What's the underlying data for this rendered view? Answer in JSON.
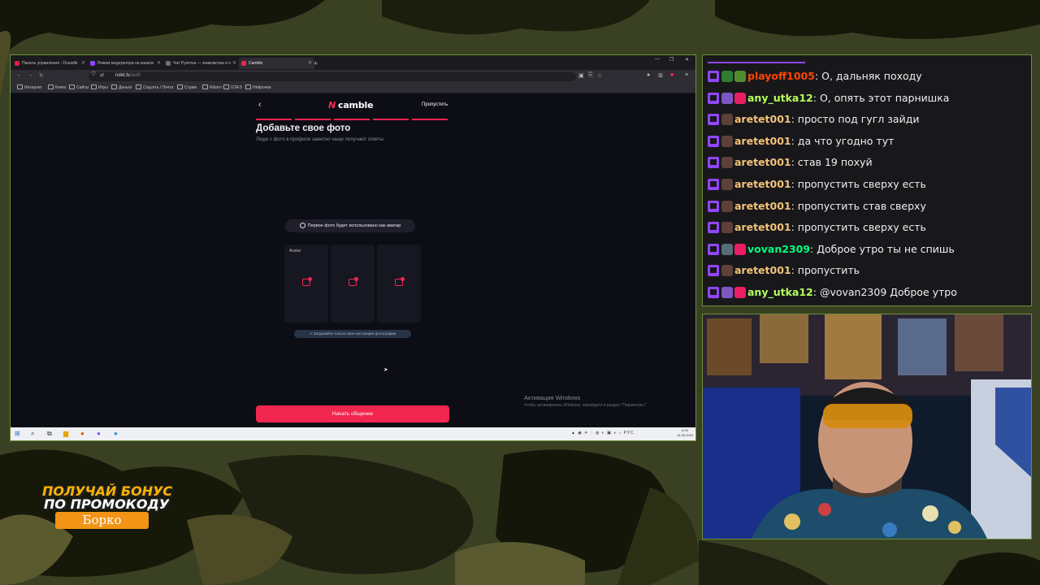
{
  "browser": {
    "tabs": [
      {
        "label": "Панель управления - Dceadki",
        "color": "#e11d48"
      },
      {
        "label": "Режим модератора на канале",
        "color": "#9146ff"
      },
      {
        "label": "Чат Рулетка — знакомства и о",
        "color": "#6b7280"
      },
      {
        "label": "Camble",
        "color": "#f0264f"
      }
    ],
    "url_host": "rulet.tv",
    "url_path": "/auth",
    "bookmarks": [
      "Интернет",
      "Книги",
      "Сайты",
      "Игры",
      "Деньги",
      "Соцсеть / Почта",
      "Стрим",
      "Riborn",
      "GTA 5",
      "Нейронки"
    ]
  },
  "page": {
    "logo": "camble",
    "skip": "Пропустить",
    "progress": {
      "steps_total": 5,
      "steps_done": 5
    },
    "title": "Добавьте свое фото",
    "subtitle": "Люди с фото в профиле заметно чаще получают ответы",
    "hint": "Первое фото будет использовано как аватар",
    "slots": [
      {
        "label": "Avatar"
      },
      {
        "label": ""
      },
      {
        "label": ""
      }
    ],
    "warning": "Загружайте только свои настоящие фотографии",
    "start_button": "Начать общение",
    "activation_title": "Активация Windows",
    "activation_sub": "Чтобы активировать Windows, перейдите в раздел \"Параметры\"."
  },
  "taskbar": {
    "lang": "РУС",
    "time": "6:26",
    "date": "14.06.2026"
  },
  "chat": {
    "messages": [
      {
        "user": "playoff1005",
        "color": "#ff4500",
        "text": "О, дальняк походу",
        "badges": [
          "#2e7d32",
          "#558b2f"
        ]
      },
      {
        "user": "any_utka12",
        "color": "#b2ff59",
        "text": "О, опять этот парнишка",
        "badges": [
          "#7e57c2",
          "#e91e63"
        ]
      },
      {
        "user": "aretet001",
        "color": "#f4c27a",
        "text": "просто под гугл зайди",
        "badges": [
          "#5d4037"
        ]
      },
      {
        "user": "aretet001",
        "color": "#f4c27a",
        "text": "да что угодно тут",
        "badges": [
          "#5d4037"
        ]
      },
      {
        "user": "aretet001",
        "color": "#f4c27a",
        "text": "став 19 похуй",
        "badges": [
          "#5d4037"
        ]
      },
      {
        "user": "aretet001",
        "color": "#f4c27a",
        "text": "пропустить сверху есть",
        "badges": [
          "#5d4037"
        ]
      },
      {
        "user": "aretet001",
        "color": "#f4c27a",
        "text": "пропустить став сверху",
        "badges": [
          "#5d4037"
        ]
      },
      {
        "user": "aretet001",
        "color": "#f4c27a",
        "text": "пропустить сверху есть",
        "badges": [
          "#5d4037"
        ]
      },
      {
        "user": "vovan2309",
        "color": "#00ff7f",
        "text": "Доброе утро ты не спишь",
        "badges": [
          "#546e7a",
          "#e91e63"
        ]
      },
      {
        "user": "aretet001",
        "color": "#f4c27a",
        "text": "пропустить",
        "badges": [
          "#5d4037"
        ]
      },
      {
        "user": "any_utka12",
        "color": "#b2ff59",
        "text": "@vovan2309 Доброе утро",
        "badges": [
          "#7e57c2",
          "#e91e63"
        ]
      }
    ]
  },
  "promo": {
    "line1": "ПОЛУЧАЙ БОНУС",
    "line2": "ПО ПРОМОКОДУ",
    "code": "Борко"
  }
}
